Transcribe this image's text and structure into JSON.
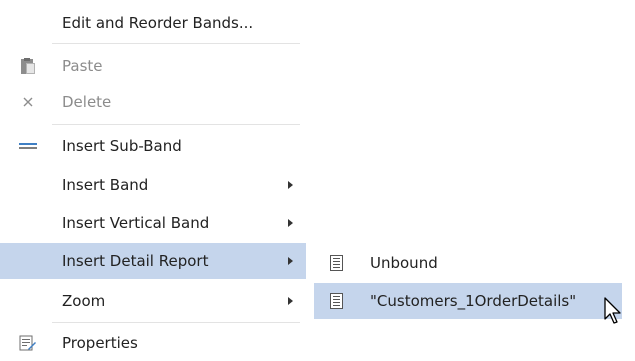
{
  "menu": {
    "items": [
      {
        "label": "Edit and Reorder Bands...",
        "enabled": true,
        "icon": "none"
      },
      {
        "label": "Paste",
        "enabled": false,
        "icon": "paste-icon"
      },
      {
        "label": "Delete",
        "enabled": false,
        "icon": "close-icon"
      },
      {
        "label": "Insert Sub-Band",
        "enabled": true,
        "icon": "sub-band-icon"
      },
      {
        "label": "Insert Band",
        "enabled": true,
        "submenu": true
      },
      {
        "label": "Insert Vertical Band",
        "enabled": true,
        "submenu": true
      },
      {
        "label": "Insert Detail Report",
        "enabled": true,
        "submenu": true,
        "highlighted": true
      },
      {
        "label": "Zoom",
        "enabled": true,
        "submenu": true
      },
      {
        "label": "Properties",
        "enabled": true,
        "icon": "properties-icon"
      }
    ]
  },
  "submenu": {
    "items": [
      {
        "label": "Unbound",
        "icon": "report-icon"
      },
      {
        "label": "\"Customers_1OrderDetails\"",
        "icon": "report-icon",
        "highlighted": true
      }
    ]
  },
  "colors": {
    "highlight": "#c5d5ec",
    "text": "#222222",
    "disabled_text": "#8c8c8c",
    "accent_blue": "#3f7fc4"
  }
}
